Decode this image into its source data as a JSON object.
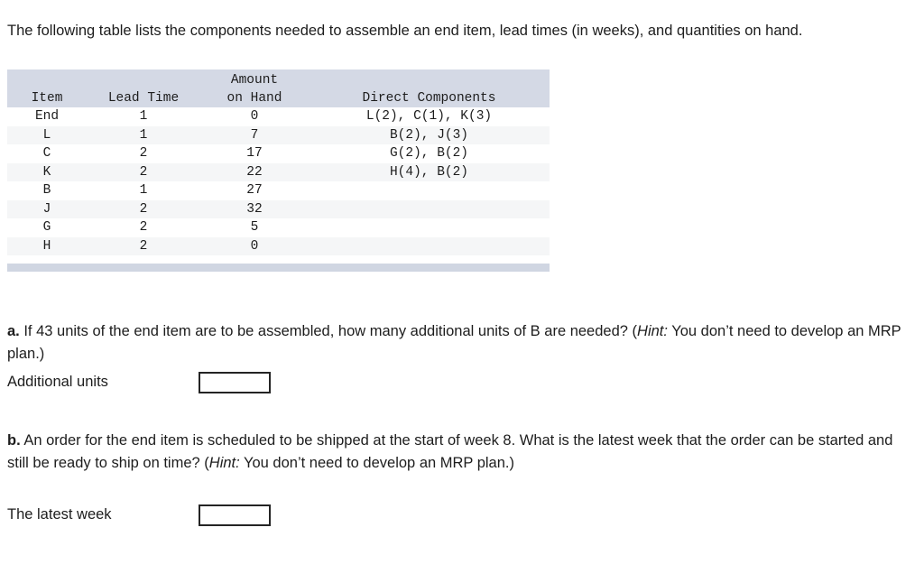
{
  "intro": {
    "text": "The following table lists the components needed to assemble an end item, lead times (in weeks), and quantities on hand."
  },
  "table": {
    "headers": {
      "item": "Item",
      "lead_time": "Lead Time",
      "amount_on_hand_line1": "Amount",
      "amount_on_hand_line2": "on Hand",
      "direct_components": "Direct Components"
    },
    "rows": [
      {
        "item": "End",
        "lead_time": "1",
        "amount_on_hand": "0",
        "direct_components": "L(2), C(1), K(3)"
      },
      {
        "item": "L",
        "lead_time": "1",
        "amount_on_hand": "7",
        "direct_components": "B(2), J(3)"
      },
      {
        "item": "C",
        "lead_time": "2",
        "amount_on_hand": "17",
        "direct_components": "G(2), B(2)"
      },
      {
        "item": "K",
        "lead_time": "2",
        "amount_on_hand": "22",
        "direct_components": "H(4), B(2)"
      },
      {
        "item": "B",
        "lead_time": "1",
        "amount_on_hand": "27",
        "direct_components": ""
      },
      {
        "item": "J",
        "lead_time": "2",
        "amount_on_hand": "32",
        "direct_components": ""
      },
      {
        "item": "G",
        "lead_time": "2",
        "amount_on_hand": "5",
        "direct_components": ""
      },
      {
        "item": "H",
        "lead_time": "2",
        "amount_on_hand": "0",
        "direct_components": ""
      }
    ]
  },
  "question_a": {
    "label": "a.",
    "text_before_hint": " If 43 units of the end item are to be assembled, how many additional units of B are needed? (",
    "hint_word": "Hint:",
    "text_after_hint": " You don’t need to develop an MRP plan.)",
    "answer_label": "Additional units",
    "answer_value": "",
    "answer_placeholder": ""
  },
  "question_b": {
    "label": "b.",
    "text_before_hint": " An order for the end item is scheduled to be shipped at the start of week 8. What is the latest week that the order can be started and still be ready to ship on time? (",
    "hint_word": "Hint:",
    "text_after_hint": " You don’t need to develop an MRP plan.)",
    "answer_label": "The latest week",
    "answer_value": "",
    "answer_placeholder": ""
  },
  "colors": {
    "header_bg": "#d4d9e5",
    "footer_bar": "#d0d6e2",
    "alt_row_bg": "#f5f6f7",
    "text": "#1d1d1d",
    "input_border": "#242424"
  }
}
